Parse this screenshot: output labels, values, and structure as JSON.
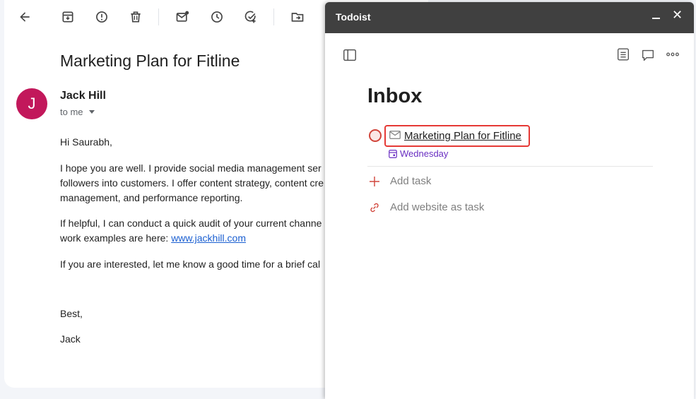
{
  "gmail": {
    "toolbar": [
      {
        "name": "back-arrow-icon"
      },
      {
        "name": "archive-icon"
      },
      {
        "name": "report-spam-icon"
      },
      {
        "name": "delete-icon"
      },
      {
        "name": "mark-unread-icon"
      },
      {
        "name": "snooze-icon"
      },
      {
        "name": "add-to-tasks-icon"
      },
      {
        "name": "move-to-icon"
      }
    ],
    "subject": "Marketing Plan for Fitline",
    "sender": {
      "avatar_letter": "J",
      "avatar_color": "#c2185b",
      "name": "Jack Hill",
      "recipient": "to me"
    },
    "body": {
      "greeting": "Hi Saurabh,",
      "para1_line1": "I hope you are well. I provide social media management ser",
      "para1_line2": "followers into customers. I offer content strategy, content cre",
      "para1_line3": "management, and performance reporting.",
      "para2_line1": "If helpful, I can conduct a quick audit of your current channe",
      "para2_line2_prefix": "work examples are here: ",
      "para2_link": "www.jackhill.com",
      "para3": "If you are interested, let me know a good time for a brief cal",
      "closing": "Best,",
      "signature": "Jack"
    }
  },
  "todoist": {
    "window_title": "Todoist",
    "minimize_icon": "minimize-icon",
    "close_glyph": "✕",
    "page_title": "Inbox",
    "task": {
      "name": "Marketing Plan for Fitline",
      "due": "Wednesday",
      "priority_color": "#d1453b",
      "highlight_color": "#e53935"
    },
    "add_task_label": "Add task",
    "add_website_label": "Add website as task",
    "accent_color": "#d1453b",
    "date_color": "#692ec2"
  }
}
